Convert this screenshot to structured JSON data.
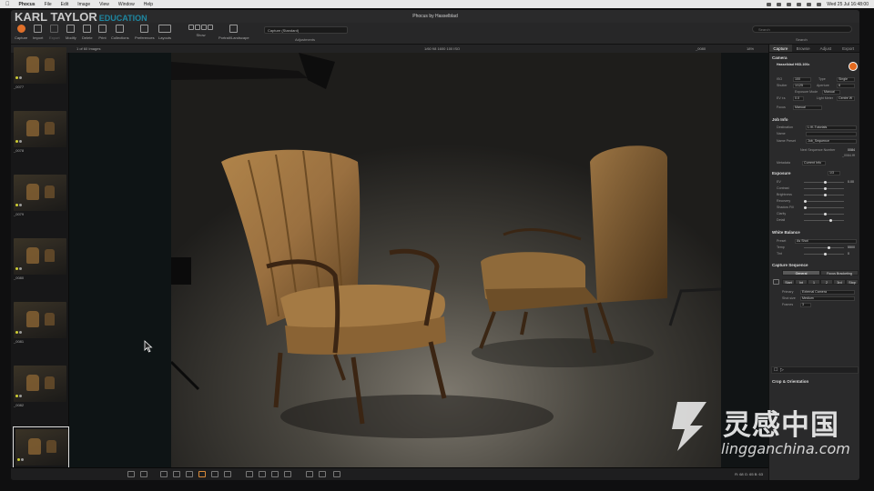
{
  "menubar": {
    "app": "Phocus",
    "items": [
      "File",
      "Edit",
      "Image",
      "View",
      "Window",
      "Help"
    ],
    "clock": "Wed 25 Jul  16:48:00"
  },
  "window": {
    "title": "Phocus by Hasselblad"
  },
  "brand": {
    "name": "KARL TAYLOR",
    "sub": "EDUCATION"
  },
  "toolbar": {
    "items": [
      {
        "label": "Capture",
        "icon": "capture-icon"
      },
      {
        "label": "Import",
        "icon": "import-icon"
      },
      {
        "label": "Export",
        "icon": "export-icon"
      },
      {
        "label": "Modify",
        "icon": "modify-icon"
      },
      {
        "label": "Delete",
        "icon": "delete-icon"
      },
      {
        "label": "Print",
        "icon": "print-icon"
      },
      {
        "label": "Collections",
        "icon": "collections-icon"
      },
      {
        "label": "Preferences",
        "icon": "preferences-icon"
      },
      {
        "label": "Layouts",
        "icon": "layouts-icon"
      },
      {
        "label": "Show",
        "icon": "show-icon"
      },
      {
        "label": "Portrait/Landscape",
        "icon": "orientation-icon"
      }
    ],
    "capture_mode": "Capture (Standard)",
    "adjustments_label": "Adjustments",
    "search_label": "Search",
    "search_placeholder": "Search"
  },
  "subbar": {
    "count": "1 of 60 Images",
    "info": "1/60  f/8  1600  100  ISO",
    "file": "_0080",
    "zoom": "18%"
  },
  "thumbnails": [
    {
      "name": "_0077"
    },
    {
      "name": "_0078"
    },
    {
      "name": "_0079"
    },
    {
      "name": "_0080"
    },
    {
      "name": "_0081"
    },
    {
      "name": "_0082"
    },
    {
      "name": "_0083",
      "selected": true
    }
  ],
  "status": {
    "coords": "R: 68  G: 65  B: 63"
  },
  "panel": {
    "tabs": [
      "Capture",
      "Browse",
      "Adjust",
      "Export"
    ],
    "active_tab": "Capture",
    "camera": {
      "title": "Camera",
      "model": "Hasselblad H6D-100c",
      "iso_label": "ISO",
      "iso": "100",
      "type_label": "Type",
      "type": "Single",
      "shutter_label": "Shutter",
      "shutter": "1/125",
      "aperture_label": "Aperture",
      "aperture": "8",
      "exposure_mode_label": "Exposure Mode",
      "exposure_mode": "Manual",
      "ev_label": "EV ±s",
      "ev": "0.0",
      "light_meter_label": "Light Meter",
      "light_meter": "Centre W",
      "focus_label": "Focus",
      "focus": "Manual"
    },
    "job_info": {
      "title": "Job Info",
      "destination_label": "Destination",
      "destination": "L:/K-Tutorials",
      "name_label": "Name",
      "name_preset_label": "Name Preset",
      "name_preset": "Job_Sequence",
      "next_seq_label": "Next Sequence Number",
      "next_seq": "0084",
      "next_file": "_0084.fff",
      "metadata_label": "Metadata",
      "metadata": "Current Info"
    },
    "exposure": {
      "title": "Exposure",
      "ev_preset": "1/3",
      "rows": [
        {
          "label": "EV",
          "value": "0.00"
        },
        {
          "label": "Contrast",
          "value": ""
        },
        {
          "label": "Brightness",
          "value": ""
        },
        {
          "label": "Recovery",
          "value": ""
        },
        {
          "label": "Shadow Fill",
          "value": ""
        },
        {
          "label": "Clarity",
          "value": ""
        },
        {
          "label": "Detail",
          "value": ""
        }
      ]
    },
    "white_balance": {
      "title": "White Balance",
      "preset_label": "Preset",
      "preset": "As Shot",
      "temp_label": "Temp",
      "temp": "5500",
      "tint_label": "Tint",
      "tint": "0"
    },
    "capture_sequence": {
      "title": "Capture Sequence",
      "tabs": [
        "General",
        "Focus Bracketing"
      ],
      "steps": [
        "Start",
        "Int",
        "1",
        "2",
        "3rd",
        "Stop"
      ],
      "primary_label": "Primary",
      "primary": "External Camera",
      "shot_size_label": "Shot size",
      "shot_size": "Medium",
      "frames_label": "Frames",
      "frames": "3"
    },
    "crop": {
      "title": "Crop & Orientation"
    }
  },
  "watermark": {
    "text": "灵感中国",
    "url": "lingganchina.com"
  }
}
